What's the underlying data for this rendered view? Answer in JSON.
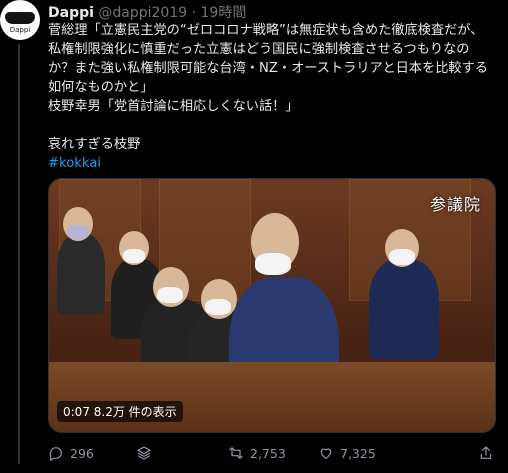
{
  "tweet": {
    "display_name": "Dappi",
    "handle": "@dappi2019",
    "separator": "·",
    "time": "19時間",
    "avatar_text": "Dappi",
    "lines": [
      "菅総理「立憲民主党の“ゼロコロナ戦略”は無症状も含めた徹底検査だが、",
      "私権制限強化に慎重だった立憲はどう国民に強制検査させるつもりなの",
      "か？また強い私権制限可能な台湾・NZ・オーストラリアと日本を比較する",
      "如何なものかと」",
      "枝野幸男「党首討論に相応しくない話！」"
    ],
    "comment": "哀れすぎる枝野",
    "hashtag": "#kokkai"
  },
  "media": {
    "watermark": "参議院",
    "duration": "0:07",
    "views": "8.2万 件の表示"
  },
  "actions": {
    "reply_count": "296",
    "retweet_count": "2,753",
    "like_count": "7,325"
  }
}
